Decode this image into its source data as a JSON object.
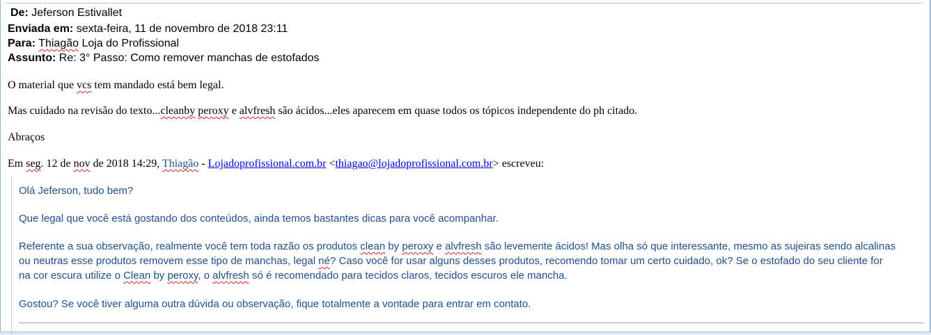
{
  "header": {
    "from_label": "De:",
    "from_value": "Jeferson Estivallet",
    "sent_label": "Enviada em:",
    "sent_value": "sexta-feira, 11 de novembro de 2018 23:11",
    "to_label": "Para:",
    "to_value_1": "Thiagão",
    "to_value_2": " Loja do Profissional",
    "subject_label": "Assunto:",
    "subject_value": "Re: 3° Passo: Como remover manchas de estofados"
  },
  "body": {
    "p1_a": "O material que ",
    "p1_b": "vcs",
    "p1_c": " tem mandado está bem legal.",
    "p2_a": "Mas cuidado na revisão do texto...",
    "p2_b": "cleanby",
    "p2_c": " ",
    "p2_d": "peroxy",
    "p2_e": " e ",
    "p2_f": "alvfresh",
    "p2_g": " são ácidos...eles aparecem em quase todos os tópicos independente do ph citado.",
    "p3": "Abraços",
    "p4_a": "Em ",
    "p4_b": "seg",
    "p4_c": ". 12 de ",
    "p4_d": "nov",
    "p4_e": " de 2018 14:29, ",
    "p4_f": "Thiagão",
    "p4_g": "  - ",
    "p4_link1": "Lojadoprofissional.com.br",
    "p4_h": " <",
    "p4_link2": "thiagao@lojadoprofissional.com.br",
    "p4_i": "> escreveu:"
  },
  "quote": {
    "q1": "Olá Jeferson, tudo bem?",
    "q2": "Que legal que você está gostando dos conteúdos, ainda temos bastantes dicas para você acompanhar.",
    "q3_a": "Referente a sua observação, realmente você tem toda razão os produtos ",
    "q3_b": "clean",
    "q3_c": " by ",
    "q3_d": "peroxy",
    "q3_e": " e ",
    "q3_f": "alvfresh",
    "q3_g": " são levemente ácidos! Mas olha só que interessante, mesmo as sujeiras sendo alcalinas",
    "q4_a": "ou neutras  esse produtos removem esse tipo de manchas, legal ",
    "q4_b": "né",
    "q4_c": "?  Caso você for usar alguns desses produtos, recomendo tomar um certo cuidado, ok? Se o estofado do seu cliente for",
    "q5_a": "na cor escura utilize o ",
    "q5_b": "Clean",
    "q5_c": " by ",
    "q5_d": "peroxy",
    "q5_e": ", o ",
    "q5_f": "alvfresh",
    "q5_g": " só é recomendado para tecidos claros, tecidos escuros ele mancha.",
    "q6": " Gostou? Se você tiver alguma outra dúvida ou observação, fique totalmente a vontade para entrar em contato."
  }
}
